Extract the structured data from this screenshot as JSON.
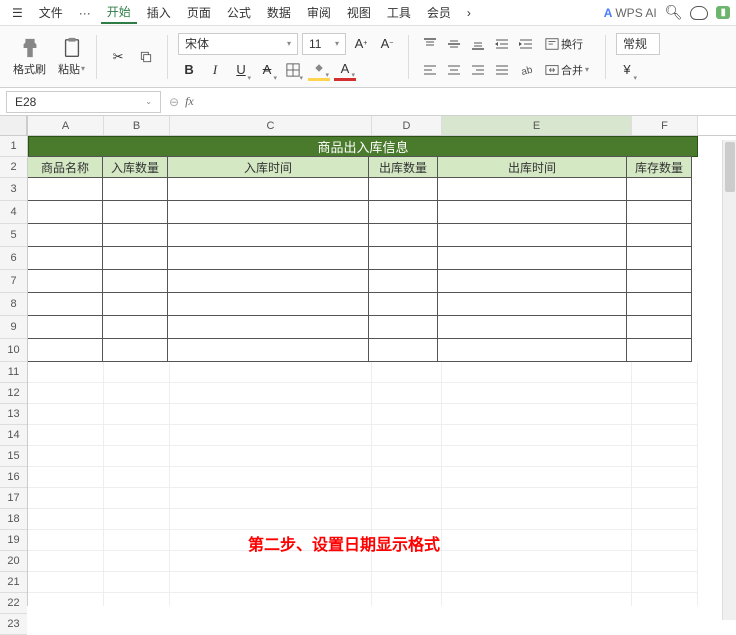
{
  "topbar": {
    "file": "文件",
    "dots": "···",
    "tabs": [
      "开始",
      "插入",
      "页面",
      "公式",
      "数据",
      "审阅",
      "视图",
      "工具",
      "会员"
    ],
    "active_index": 0,
    "ai_label": "WPS AI"
  },
  "ribbon": {
    "format_painter": "格式刷",
    "paste": "粘贴",
    "font_name": "宋体",
    "font_size": "11",
    "wrap": "换行",
    "merge": "合并",
    "format": "常规",
    "currency": "¥"
  },
  "formula_bar": {
    "namebox": "E28",
    "fx": "fx",
    "value": ""
  },
  "columns": [
    {
      "id": "A",
      "w": "wA",
      "sel": false
    },
    {
      "id": "B",
      "w": "wB",
      "sel": false
    },
    {
      "id": "C",
      "w": "wC",
      "sel": false
    },
    {
      "id": "D",
      "w": "wD",
      "sel": false
    },
    {
      "id": "E",
      "w": "wE",
      "sel": true
    },
    {
      "id": "F",
      "w": "wF",
      "sel": false
    }
  ],
  "rows": [
    1,
    2,
    3,
    4,
    5,
    6,
    7,
    8,
    9,
    10,
    11,
    12,
    13,
    14,
    15,
    16,
    17,
    18,
    19,
    20,
    21,
    22,
    23
  ],
  "table": {
    "title": "商品出入库信息",
    "headers": [
      "商品名称",
      "入库数量",
      "入库时间",
      "出库数量",
      "出库时间",
      "库存数量"
    ]
  },
  "annotation": "第二步、设置日期显示格式"
}
